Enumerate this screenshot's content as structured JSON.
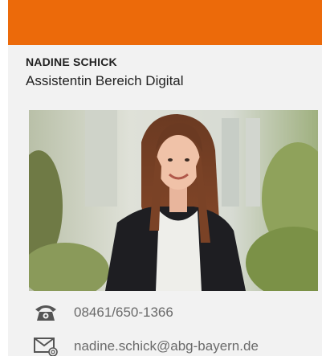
{
  "colors": {
    "accent": "#ec6a0a",
    "card_background": "#f2f2f2",
    "text_dark": "#222222",
    "text_muted": "#6a6a6a"
  },
  "person": {
    "name": "NADINE SCHICK",
    "role": "Assistentin Bereich Digital"
  },
  "photo": {
    "icon": "portrait-photo"
  },
  "contact": {
    "phone": {
      "icon": "telephone-icon",
      "text": "08461/650-1366"
    },
    "email": {
      "icon": "envelope-at-icon",
      "text": "nadine.schick@abg-bayern.de"
    }
  }
}
